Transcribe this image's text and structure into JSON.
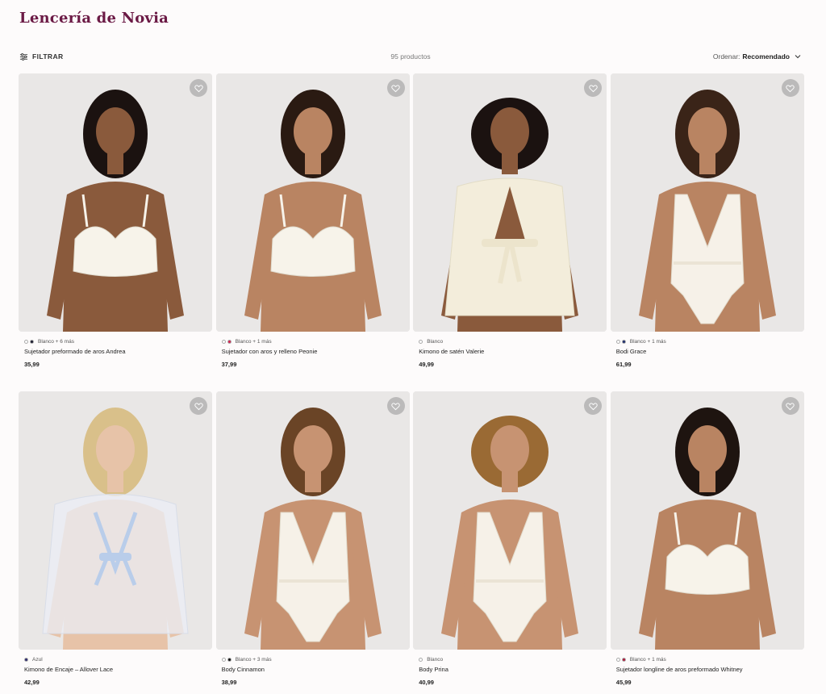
{
  "header": {
    "title": "Lencería de Novia"
  },
  "toolbar": {
    "filter_label": "FILTRAR",
    "count": "95 productos",
    "sort_label": "Ordenar:",
    "sort_value": "Recomendado"
  },
  "products": [
    {
      "colors": [
        "#ffffff",
        "#1a1a2e"
      ],
      "color_label": "Blanco + 6 más",
      "name": "Sujetador preformado de aros Andrea",
      "price": "35,99",
      "skin": "#8a5a3c",
      "hair": "#1b1210",
      "garment": "bra"
    },
    {
      "colors": [
        "#ffffff",
        "#d6204e"
      ],
      "color_label": "Blanco + 1 más",
      "name": "Sujetador con aros y relleno Peonie",
      "price": "37,99",
      "skin": "#b98462",
      "hair": "#2a1a12",
      "garment": "bra"
    },
    {
      "colors": [
        "#ffffff"
      ],
      "color_label": "Blanco",
      "name": "Kimono de satén Valerie",
      "price": "49,99",
      "skin": "#8a5a3c",
      "hair": "#1b1210",
      "garment": "robe"
    },
    {
      "colors": [
        "#ffffff",
        "#1c2b6b"
      ],
      "color_label": "Blanco + 1 más",
      "name": "Bodi Grace",
      "price": "61,99",
      "skin": "#b98462",
      "hair": "#3a2418",
      "garment": "body"
    },
    {
      "colors": [
        "#2d2a6e"
      ],
      "color_label": "Azul",
      "name": "Kimono de Encaje – Allover Lace",
      "price": "42,99",
      "skin": "#e7c3a8",
      "hair": "#d9c08a",
      "garment": "lace-robe"
    },
    {
      "colors": [
        "#ffffff",
        "#111111"
      ],
      "color_label": "Blanco + 3 más",
      "name": "Body Cinnamon",
      "price": "38,99",
      "skin": "#c79372",
      "hair": "#6a4426",
      "garment": "body"
    },
    {
      "colors": [
        "#ffffff"
      ],
      "color_label": "Blanco",
      "name": "Body Prina",
      "price": "40,99",
      "skin": "#c79372",
      "hair": "#9a6a34",
      "garment": "body"
    },
    {
      "colors": [
        "#ffffff",
        "#b0173a"
      ],
      "color_label": "Blanco + 1 más",
      "name": "Sujetador longline de aros preformado Whitney",
      "price": "45,99",
      "skin": "#b98462",
      "hair": "#1e1410",
      "garment": "bra"
    }
  ]
}
